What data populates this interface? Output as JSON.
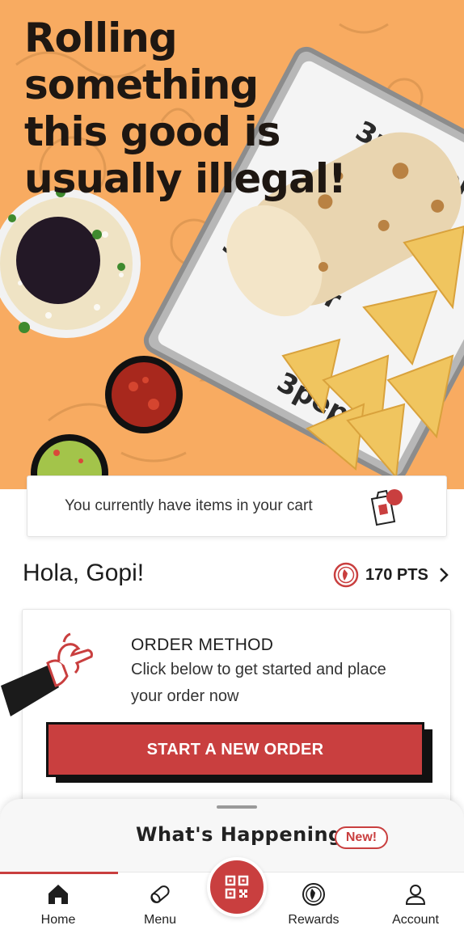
{
  "hero": {
    "headline_lines": [
      "Rolling something",
      "this good is",
      "usually illegal!"
    ],
    "background_color": "#f8ab61",
    "wrapper_brand_text": "3pepper",
    "wrapper_small_text": "Order O"
  },
  "cart_banner": {
    "message": "You currently have items in your cart",
    "icon": "cart-bag-icon"
  },
  "greeting": {
    "text": "Hola, Gopi!"
  },
  "points": {
    "label": "170 PTS",
    "icon": "pepper-points-icon"
  },
  "order_method": {
    "title": "ORDER METHOD",
    "description": "Click below to get started and place your order now",
    "button_label": "START A NEW ORDER"
  },
  "whats_happening": {
    "title": "What's Happening",
    "badge": "New!"
  },
  "nav": {
    "items": [
      {
        "label": "Home",
        "icon": "home-icon",
        "active": true
      },
      {
        "label": "Menu",
        "icon": "burrito-icon"
      },
      {
        "label": "Rewards",
        "icon": "pepper-icon"
      },
      {
        "label": "Account",
        "icon": "user-icon"
      }
    ],
    "center_button_icon": "qr-code-icon"
  },
  "colors": {
    "accent": "#c93f3f",
    "hero_orange": "#f8ab61",
    "text": "#1d1d1d"
  }
}
